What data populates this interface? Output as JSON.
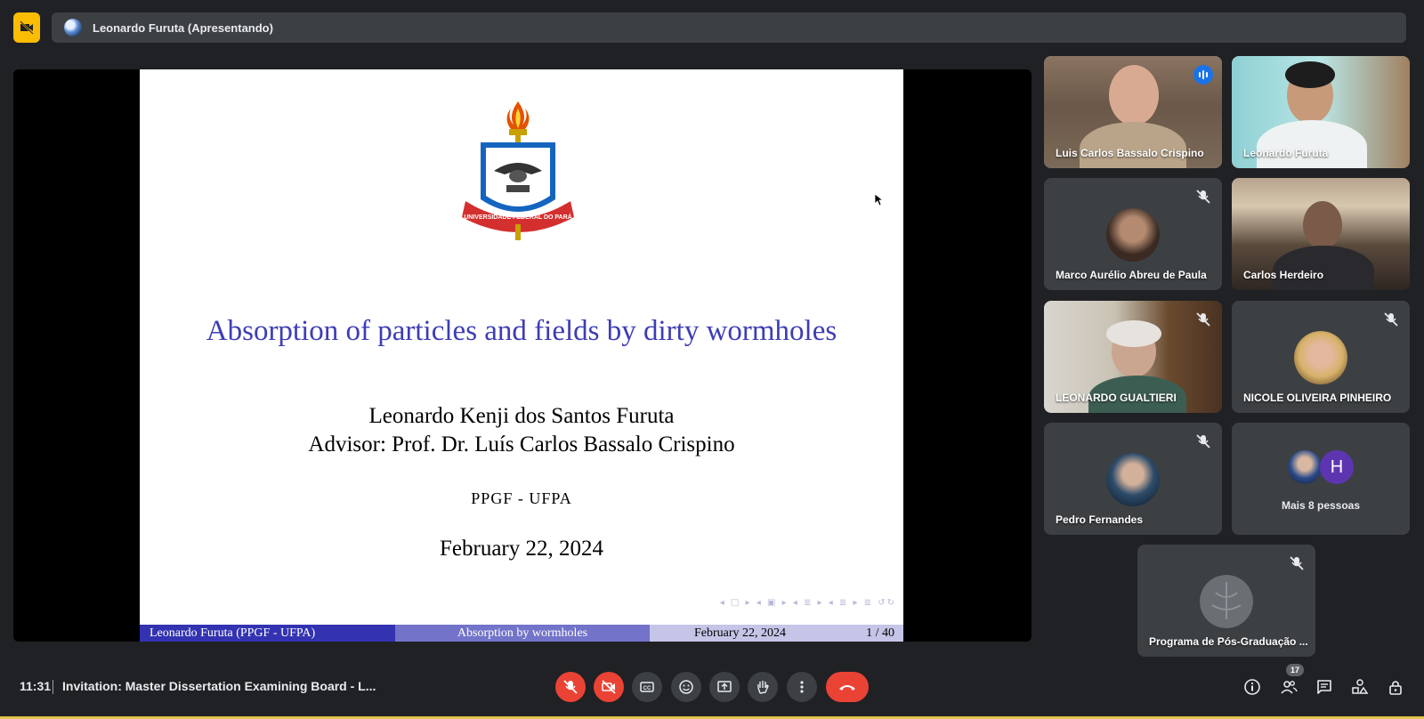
{
  "presenter": {
    "name": "Leonardo Furuta (Apresentando)"
  },
  "slide": {
    "crest_text": "UNIVERSIDADE FEDERAL DO PARÁ",
    "title": "Absorption of particles and fields by dirty wormholes",
    "author": "Leonardo Kenji dos Santos Furuta",
    "advisor": "Advisor: Prof. Dr. Luís Carlos Bassalo Crispino",
    "institution": "PPGF - UFPA",
    "date": "February 22, 2024",
    "footer_left": "Leonardo Furuta  (PPGF - UFPA)",
    "footer_center": "Absorption by wormholes",
    "footer_date": "February 22, 2024",
    "footer_page": "1 / 40",
    "nav_symbols": "◂ □ ▸ ◂ ▣ ▸ ◂ ≣ ▸ ◂ ≣ ▸ ≣ ↺↻"
  },
  "participants": [
    {
      "name": "Luis Carlos Bassalo Crispino",
      "speaking": true,
      "muted": false
    },
    {
      "name": "Leonardo Furuta",
      "speaking": false,
      "muted": false
    },
    {
      "name": "Marco Aurélio Abreu de Paula",
      "speaking": false,
      "muted": true
    },
    {
      "name": "Carlos Herdeiro",
      "speaking": false,
      "muted": false
    },
    {
      "name": "LEONARDO GUALTIERI",
      "speaking": false,
      "muted": true
    },
    {
      "name": "NICOLE OLIVEIRA PINHEIRO",
      "speaking": false,
      "muted": true
    },
    {
      "name": "Pedro Fernandes",
      "speaking": false,
      "muted": true
    },
    {
      "name": "Mais 8 pessoas",
      "avatar_letter": "H"
    },
    {
      "name": "Programa de Pós-Graduação ...",
      "speaking": false,
      "muted": true
    }
  ],
  "bottom_bar": {
    "time": "11:31",
    "meeting_title": "Invitation: Master Dissertation Examining Board - L...",
    "people_count": "17"
  },
  "colors": {
    "background": "#202124",
    "danger": "#ea4335",
    "accent": "#8ab4f8",
    "beamer_blue": "#3333b2"
  },
  "icons": [
    "camera-off-icon",
    "mic-off-icon",
    "video-off-icon",
    "captions-icon",
    "emoji-icon",
    "present-icon",
    "raise-hand-icon",
    "more-options-icon",
    "hangup-icon",
    "info-icon",
    "people-icon",
    "chat-icon",
    "activities-icon",
    "host-controls-icon"
  ]
}
